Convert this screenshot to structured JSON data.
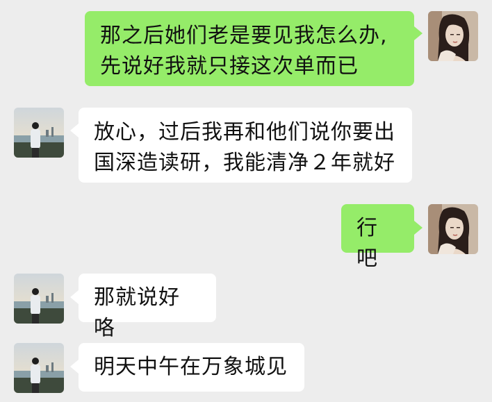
{
  "colors": {
    "background": "#ededed",
    "sent_bubble": "#95ec69",
    "received_bubble": "#ffffff",
    "text": "#111111"
  },
  "participants": {
    "self_avatar_icon": "woman-portrait-avatar-icon",
    "contact_avatar_icon": "man-by-river-avatar-icon"
  },
  "messages": [
    {
      "sender": "self",
      "text": "那之后她们老是要见我怎么办,\n先说好我就只接这次单而已"
    },
    {
      "sender": "contact",
      "text": "放心，过后我再和他们说你要出\n国深造读研，我能清净２年就好"
    },
    {
      "sender": "self",
      "text": "行吧"
    },
    {
      "sender": "contact",
      "text": "那就说好咯"
    },
    {
      "sender": "contact",
      "text": "明天中午在万象城见"
    }
  ]
}
